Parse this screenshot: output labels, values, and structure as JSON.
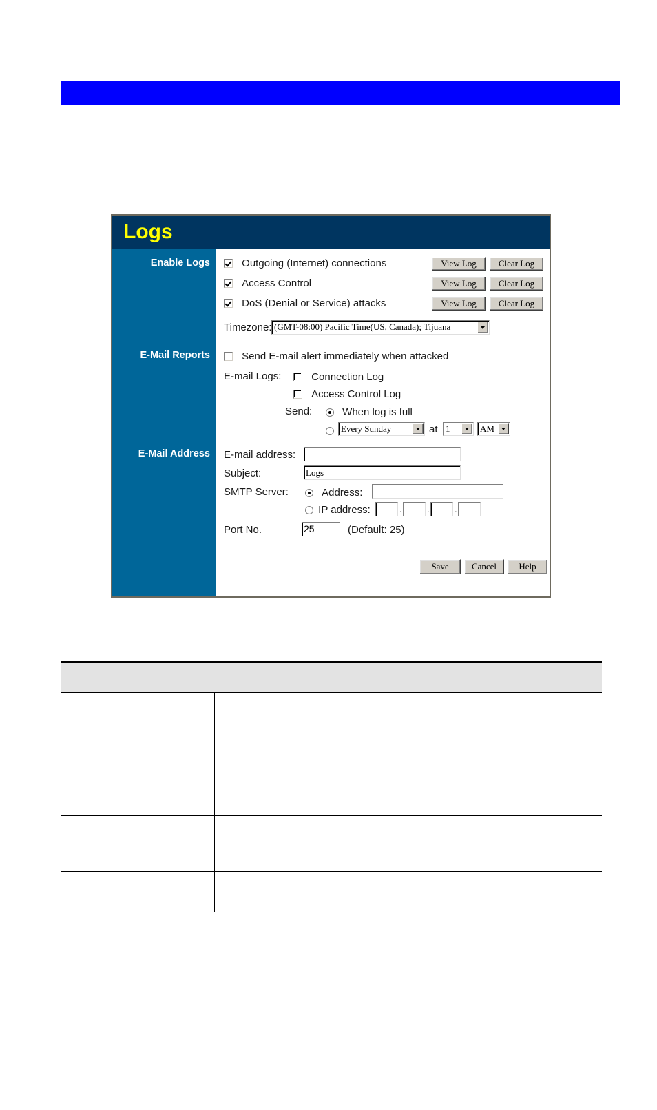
{
  "page": {
    "banner_color": "#0000ff",
    "background_color": "#ffffff"
  },
  "panel": {
    "title": "Logs",
    "title_color": "#ffff00",
    "header_color": "#003560",
    "sidebar_color": "#006699",
    "sidebar": {
      "enable_logs": "Enable Logs",
      "email_reports": "E-Mail Reports",
      "email_address": "E-Mail Address"
    },
    "enable_logs": {
      "rows": [
        {
          "label": "Outgoing (Internet) connections",
          "checked": true,
          "view_button": "View Log",
          "clear_button": "Clear Log"
        },
        {
          "label": "Access Control",
          "checked": true,
          "view_button": "View Log",
          "clear_button": "Clear Log"
        },
        {
          "label": "DoS (Denial or Service) attacks",
          "checked": true,
          "view_button": "View Log",
          "clear_button": "Clear Log"
        }
      ],
      "timezone_label": "Timezone:",
      "timezone_value": "(GMT-08:00) Pacific Time(US, Canada); Tijuana"
    },
    "email_reports": {
      "alert_checkbox_label": "Send E-mail alert immediately when attacked",
      "alert_checked": false,
      "email_logs_label": "E-mail Logs:",
      "connection_log_label": "Connection Log",
      "connection_log_checked": false,
      "access_control_log_label": "Access Control Log",
      "access_control_log_checked": false,
      "send_label": "Send:",
      "when_full_label": "When log is full",
      "when_full_selected": true,
      "schedule_selected": false,
      "schedule_day": "Every Sunday",
      "at_label": "at",
      "schedule_hour": "1",
      "schedule_ampm": "AM"
    },
    "email_address": {
      "email_label": "E-mail address:",
      "email_value": "",
      "subject_label": "Subject:",
      "subject_value": "Logs",
      "smtp_label": "SMTP Server:",
      "smtp_address_radio_label": "Address:",
      "smtp_address_selected": true,
      "smtp_address_value": "",
      "smtp_ip_radio_label": "IP address:",
      "smtp_ip_selected": false,
      "smtp_ip_octets": [
        "",
        "",
        "",
        ""
      ],
      "port_label": "Port No.",
      "port_value": "25",
      "port_default_note": "(Default: 25)"
    },
    "buttons": {
      "save": "Save",
      "cancel": "Cancel",
      "help": "Help"
    }
  },
  "desc_table": {
    "header": "",
    "rows": [
      {
        "key": "",
        "value": ""
      },
      {
        "key": "",
        "value": ""
      },
      {
        "key": "",
        "value": ""
      },
      {
        "key": "",
        "value": ""
      }
    ]
  }
}
